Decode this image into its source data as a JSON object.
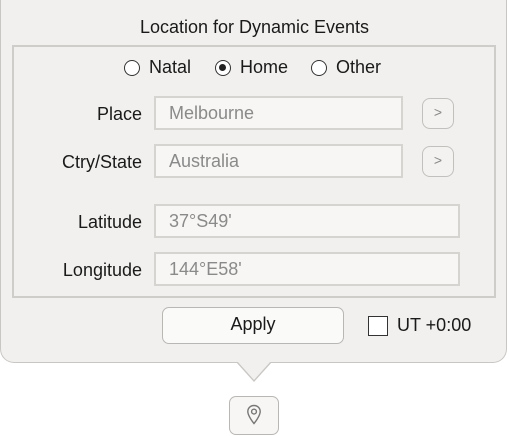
{
  "dialog": {
    "title": "Location for Dynamic Events"
  },
  "location_type": {
    "options": [
      {
        "label": "Natal",
        "selected": false
      },
      {
        "label": "Home",
        "selected": true
      },
      {
        "label": "Other",
        "selected": false
      }
    ]
  },
  "fields": {
    "place": {
      "label": "Place",
      "value": "Melbourne",
      "button": ">"
    },
    "country_state": {
      "label": "Ctry/State",
      "value": "Australia",
      "button": ">"
    },
    "latitude": {
      "label": "Latitude",
      "value": "37°S49'"
    },
    "longitude": {
      "label": "Longitude",
      "value": "144°E58'"
    }
  },
  "actions": {
    "apply_label": "Apply",
    "ut_label": "UT +0:00",
    "ut_checked": false
  },
  "icons": {
    "location": "location-pin-icon"
  }
}
